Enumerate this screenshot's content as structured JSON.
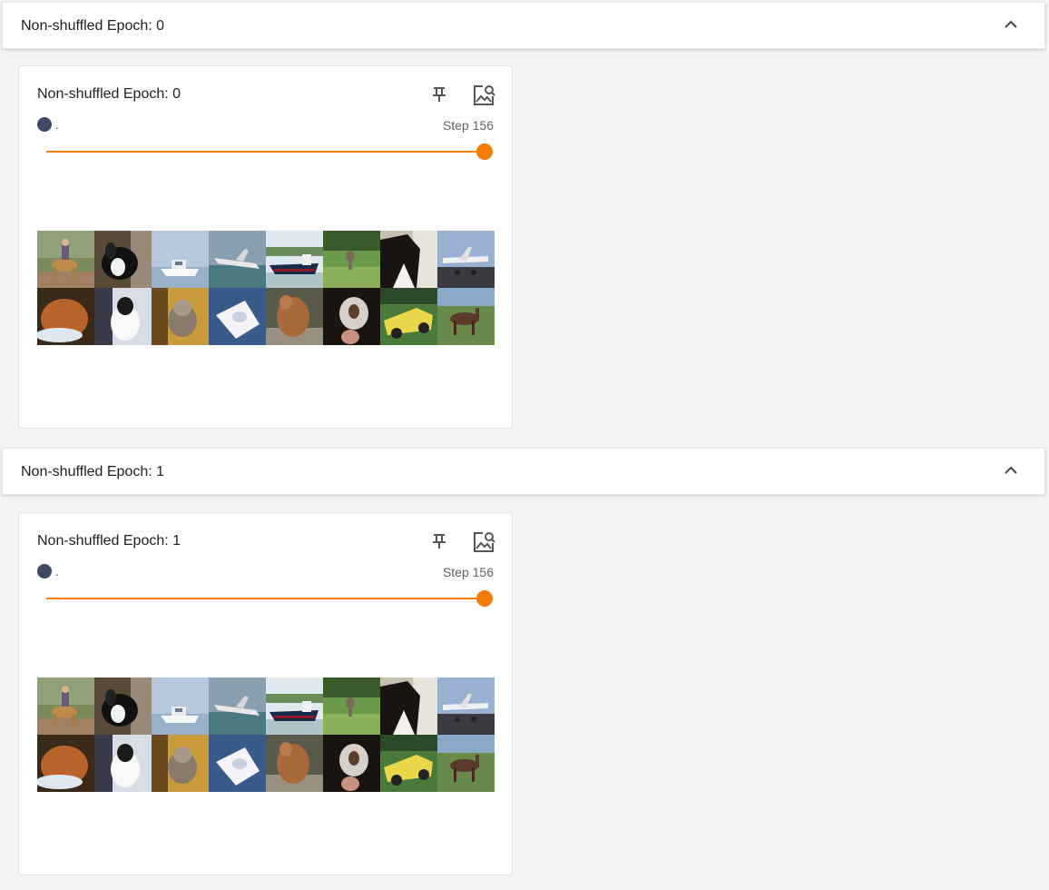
{
  "groups": [
    {
      "header_title": "Non-shuffled Epoch: 0",
      "card": {
        "title": "Non-shuffled Epoch: 0",
        "run_name": ".",
        "run_color": "#3d4a63",
        "step_label": "Step",
        "step_value": "156",
        "slider_fraction": 1.0,
        "slider_color": "#f57c00",
        "icons": [
          "pin-icon",
          "image-search-icon"
        ],
        "images": [
          "horse-rider",
          "dog",
          "boat",
          "airplane",
          "ship",
          "deer",
          "horse",
          "airplane",
          "cat",
          "dog",
          "cat",
          "boat",
          "dog",
          "dog",
          "car",
          "horse"
        ]
      }
    },
    {
      "header_title": "Non-shuffled Epoch: 1",
      "card": {
        "title": "Non-shuffled Epoch: 1",
        "run_name": ".",
        "run_color": "#3d4a63",
        "step_label": "Step",
        "step_value": "156",
        "slider_fraction": 1.0,
        "slider_color": "#f57c00",
        "icons": [
          "pin-icon",
          "image-search-icon"
        ],
        "images": [
          "horse-rider",
          "dog",
          "boat",
          "airplane",
          "ship",
          "deer",
          "horse",
          "airplane",
          "cat",
          "dog",
          "cat",
          "boat",
          "dog",
          "dog",
          "car",
          "horse"
        ]
      }
    }
  ]
}
